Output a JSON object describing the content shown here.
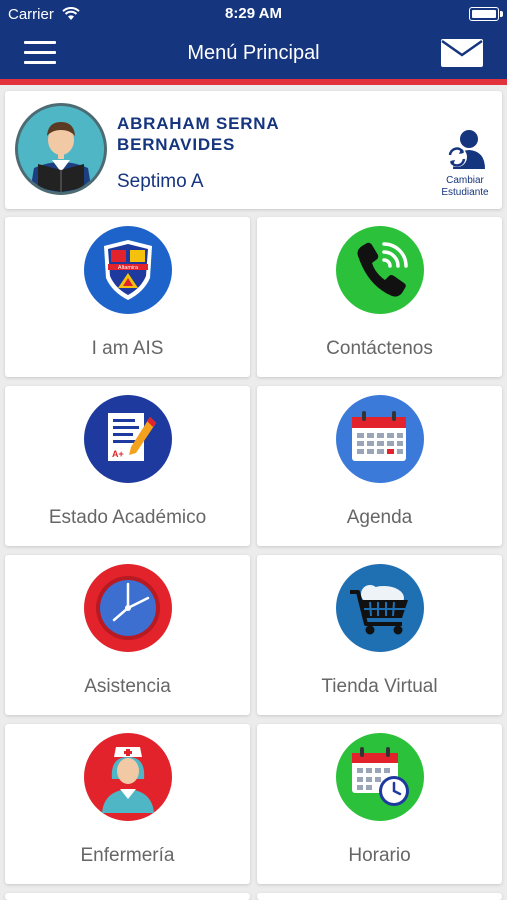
{
  "status_bar": {
    "carrier": "Carrier",
    "time": "8:29 AM"
  },
  "nav": {
    "title": "Menú Principal"
  },
  "student": {
    "name_line1": "ABRAHAM  SERNA",
    "name_line2": "BERNAVIDES",
    "grade": "Septimo A",
    "change_label_line1": "Cambiar",
    "change_label_line2": "Estudiante"
  },
  "menu": [
    {
      "label": "I am AIS",
      "icon": "school-shield-icon",
      "color": "#1e63c9",
      "crest_text": "Altamira"
    },
    {
      "label": "Contáctenos",
      "icon": "phone-icon",
      "color": "#2cc13a"
    },
    {
      "label": "Estado Académico",
      "icon": "report-card-icon",
      "color": "#1e3a9e",
      "grade_text": "A+"
    },
    {
      "label": "Agenda",
      "icon": "calendar-icon",
      "color": "#3c7ad9"
    },
    {
      "label": "Asistencia",
      "icon": "clock-icon",
      "color": "#e2232b"
    },
    {
      "label": "Tienda Virtual",
      "icon": "shopping-cart-icon",
      "color": "#1f6fb3"
    },
    {
      "label": "Enfermería",
      "icon": "nurse-icon",
      "color": "#e2232b"
    },
    {
      "label": "Horario",
      "icon": "schedule-icon",
      "color": "#2cc13a"
    }
  ],
  "colors": {
    "nav_bg": "#16357f",
    "accent_red": "#e2333d",
    "text_primary": "#16357f",
    "tile_label": "#666666"
  }
}
